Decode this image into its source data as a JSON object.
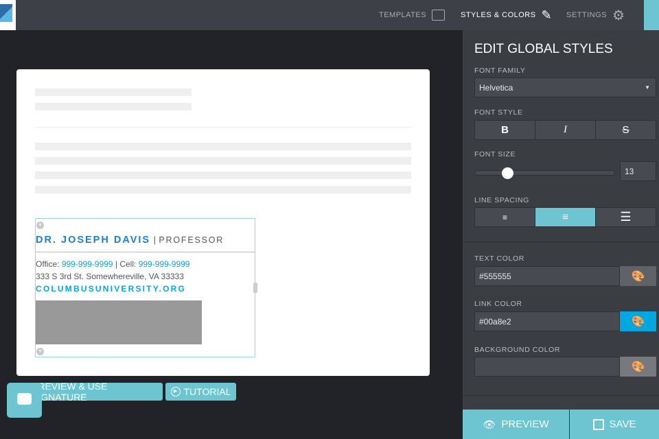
{
  "nav": {
    "templates": "TEMPLATES",
    "styles": "STYLES & COLORS",
    "settings": "SETTINGS"
  },
  "signature": {
    "name": "DR. JOSEPH DAVIS",
    "sep": "|",
    "title": "PROFESSOR",
    "office_label": "Office:",
    "office": "999-999-9999",
    "cell_label": "| Cell:",
    "cell": "999-999-9999",
    "address": "333 S 3rd St. Somewhereville, VA 33333",
    "website": "COLUMBUSUNIVERSITY.ORG"
  },
  "actions": {
    "preview_use": "PREVIEW & USE SIGNATURE",
    "tutorial": "TUTORIAL"
  },
  "panel": {
    "title": "EDIT GLOBAL STYLES",
    "font_family_label": "FONT FAMILY",
    "font_family": "Helvetica",
    "font_style_label": "FONT STYLE",
    "font_size_label": "FONT SIZE",
    "font_size": "13",
    "font_size_slider_fraction": 0.23,
    "line_spacing_label": "LINE SPACING",
    "line_spacing_selected": "medium",
    "text_color_label": "TEXT COLOR",
    "text_color": "#555555",
    "link_color_label": "LINK COLOR",
    "link_color": "#00a8e2",
    "bg_color_label": "BACKGROUND COLOR",
    "bg_color": "",
    "preview": "PREVIEW",
    "save": "SAVE"
  },
  "colors": {
    "accent": "#6cc5d0",
    "link": "#00a8e2",
    "name": "#1a7fcf"
  }
}
